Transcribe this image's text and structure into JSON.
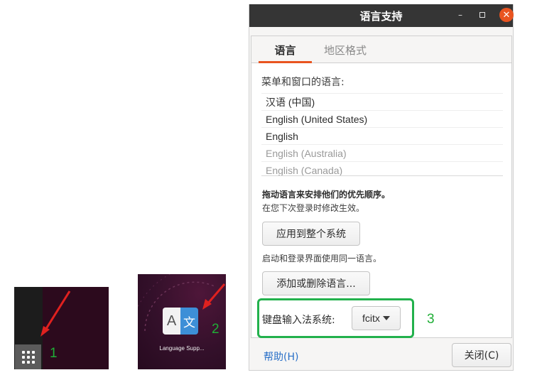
{
  "annotations": {
    "step1": "1",
    "step2": "2",
    "step3": "3",
    "highlight_color": "#22b14c",
    "arrow_color": "#e0211f"
  },
  "dock": {
    "show_apps_icon": "grid-9-dots-icon"
  },
  "launcher": {
    "tile_left_glyph": "A",
    "tile_right_glyph": "文",
    "caption": "Language Supp..."
  },
  "dialog": {
    "title": "语言支持",
    "minimize_glyph": "–",
    "close_glyph": "✕",
    "tabs": [
      {
        "label": "语言"
      },
      {
        "label": "地区格式"
      }
    ],
    "language_heading": "菜单和窗口的语言:",
    "languages": [
      {
        "label": "汉语 (中国)"
      },
      {
        "label": "English (United States)"
      },
      {
        "label": "English"
      },
      {
        "label": "English (Australia)"
      },
      {
        "label": "English (Canada)"
      }
    ],
    "drag_note": "拖动语言来安排他们的优先顺序。",
    "login_note": "在您下次登录时修改生效。",
    "apply_button": "应用到整个系统",
    "same_language_note": "启动和登录界面使用同一语言。",
    "add_remove_button": "添加或删除语言...",
    "input_method_label": "键盘输入法系统:",
    "input_method_value": "fcitx",
    "help_link": "帮助(H)",
    "close_button": "关闭(C)",
    "accent_color": "#e95420"
  }
}
